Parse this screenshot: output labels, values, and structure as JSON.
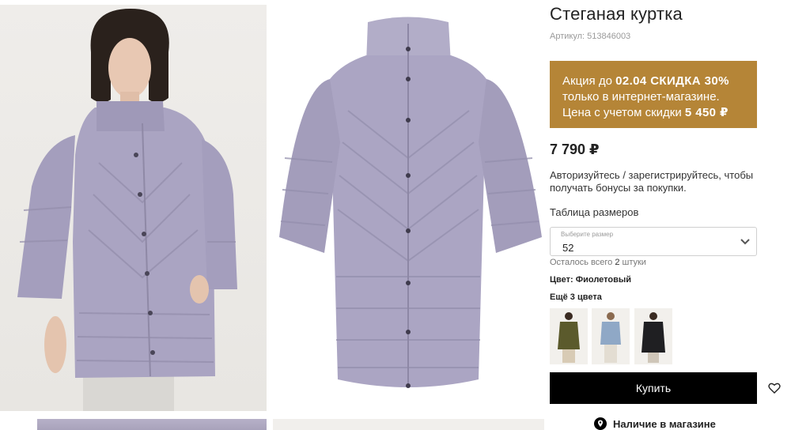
{
  "product": {
    "title": "Стеганая куртка",
    "article": "Артикул: 513846003"
  },
  "promo": {
    "line1_prefix": "Акция до ",
    "line1_highlight": "02.04 СКИДКА 30%",
    "line2": "только в интернет-магазине.",
    "line3_prefix": "Цена с учетом скидки ",
    "line3_highlight": "5 450 ₽",
    "background_color": "#b58537"
  },
  "price": "7 790 ₽",
  "bonus_text": "Авторизуйтесь / зарегистрируйтесь, чтобы получать бонусы за покупки.",
  "size": {
    "table_link": "Таблица размеров",
    "select_label": "Выберите размер",
    "select_value": "52",
    "stock_prefix": "Осталось всего ",
    "stock_count": "2",
    "stock_suffix": " штуки"
  },
  "color": {
    "label": "Цвет: Фиолетовый",
    "more_label": "Ещё 3 цвета",
    "variants": [
      "olive",
      "light-blue",
      "black"
    ]
  },
  "actions": {
    "buy_label": "Купить",
    "availability_label": "Наличие в магазине"
  },
  "icons": {
    "chevron": "chevron-down-icon",
    "favorite": "heart-icon",
    "location": "location-pin-icon"
  }
}
